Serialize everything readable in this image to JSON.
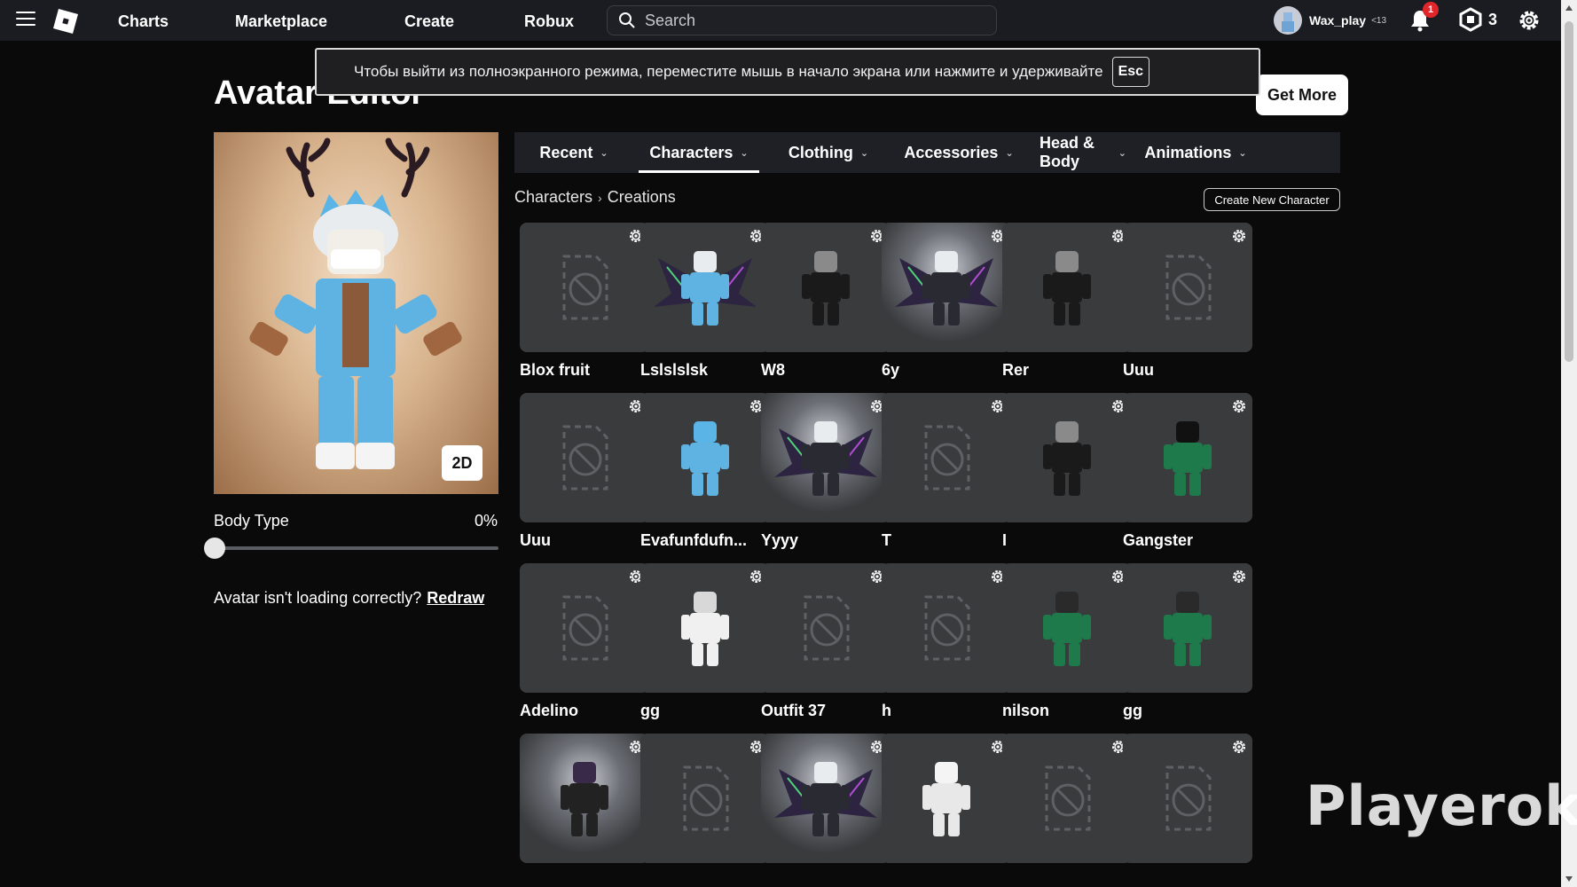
{
  "nav": {
    "links": [
      "Charts",
      "Marketplace",
      "Create",
      "Robux"
    ],
    "search_placeholder": "Search",
    "username": "Wax_play",
    "age_badge": "<13",
    "notifications": "1",
    "robux_count": "3"
  },
  "toast": {
    "message": "Чтобы выйти из полноэкранного режима, переместите мышь в начало экрана или нажмите и удерживайте",
    "key": "Esc"
  },
  "page": {
    "title": "Avatar Editor",
    "get_more": "Get More"
  },
  "preview": {
    "toggle_label": "2D",
    "body_type_label": "Body Type",
    "body_type_value": "0%",
    "body_type_fraction": 0,
    "redraw_prompt": "Avatar isn't loading correctly?",
    "redraw_link": "Redraw"
  },
  "tabs": [
    {
      "label": "Recent"
    },
    {
      "label": "Characters",
      "active": true
    },
    {
      "label": "Clothing"
    },
    {
      "label": "Accessories"
    },
    {
      "label": "Head & Body"
    },
    {
      "label": "Animations"
    }
  ],
  "breadcrumb": {
    "root": "Characters",
    "current": "Creations"
  },
  "create_new_label": "Create New Character",
  "characters": [
    {
      "name": "Blox fruit",
      "thumb": "placeholder"
    },
    {
      "name": "Lslslslsk",
      "thumb": "winged-blue"
    },
    {
      "name": "W8",
      "thumb": "beanie-black"
    },
    {
      "name": "6y",
      "thumb": "winged-dark"
    },
    {
      "name": "Rer",
      "thumb": "beanie-black"
    },
    {
      "name": "Uuu",
      "thumb": "placeholder"
    },
    {
      "name": "Uuu",
      "thumb": "placeholder"
    },
    {
      "name": "Evafunfdufn...",
      "thumb": "blue-crown"
    },
    {
      "name": "Yyyy",
      "thumb": "winged-dark"
    },
    {
      "name": "T",
      "thumb": "placeholder"
    },
    {
      "name": "I",
      "thumb": "beanie-black"
    },
    {
      "name": "Gangster",
      "thumb": "green-hood"
    },
    {
      "name": "Adelino",
      "thumb": "placeholder"
    },
    {
      "name": "gg",
      "thumb": "white-bear"
    },
    {
      "name": "Outfit 37",
      "thumb": "placeholder"
    },
    {
      "name": "h",
      "thumb": "placeholder"
    },
    {
      "name": "nilson",
      "thumb": "green-jacket"
    },
    {
      "name": "gg",
      "thumb": "green-jacket"
    },
    {
      "name": "",
      "thumb": "horned-purple"
    },
    {
      "name": "",
      "thumb": "placeholder"
    },
    {
      "name": "",
      "thumb": "winged-dark"
    },
    {
      "name": "",
      "thumb": "white-hair"
    },
    {
      "name": "",
      "thumb": "placeholder"
    },
    {
      "name": "",
      "thumb": "placeholder"
    }
  ],
  "watermark": "Playerok",
  "colors": {
    "topbar": "#1a1c21",
    "page_bg": "#0a0a0b",
    "tile_bg": "#393b3d",
    "notification_red": "#e0262b"
  }
}
